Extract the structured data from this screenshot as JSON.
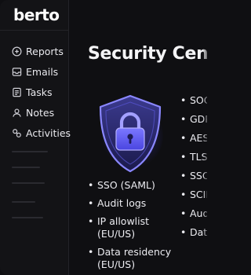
{
  "app": {
    "logo": "berto"
  },
  "sidebar": {
    "items": [
      {
        "label": "Reports",
        "icon": "reports-icon"
      },
      {
        "label": "Emails",
        "icon": "mail-icon"
      },
      {
        "label": "Tasks",
        "icon": "tasks-icon"
      },
      {
        "label": "Notes",
        "icon": "user-icon"
      },
      {
        "label": "Activities",
        "icon": "activities-icon"
      }
    ]
  },
  "main": {
    "title": "Security Center",
    "illustration": "shield-lock-icon",
    "features_left": [
      "SSO (SAML)",
      "Audit logs",
      "IP allowlist (EU/US)",
      "Data residency (EU/US)"
    ],
    "features_right": [
      "SOC",
      "GDP",
      "AES",
      "TLS",
      "SSO",
      "SCIM",
      "Aud",
      "Data (EU"
    ]
  },
  "colors": {
    "background": "#0f0f12",
    "sidebar": "#131316",
    "accent": "#5b55f5",
    "text": "#ececf1"
  }
}
